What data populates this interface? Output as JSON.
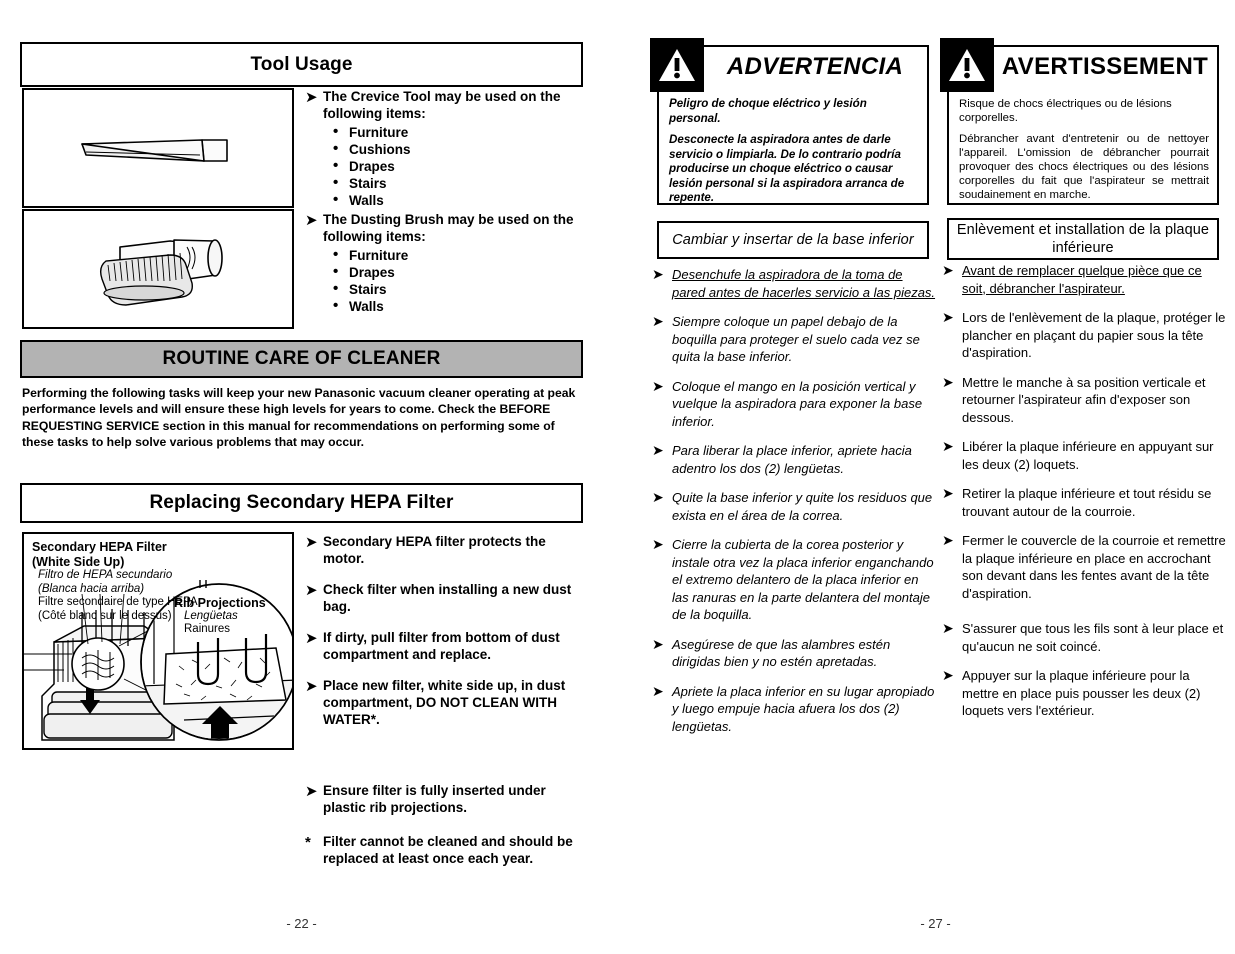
{
  "left_page": {
    "tool_usage": {
      "title": "Tool Usage",
      "crevice_figure_name": "crevice-tool-illustration",
      "brush_figure_name": "dusting-brush-illustration",
      "bullets": [
        {
          "text": "The Crevice Tool may be used on the following items:",
          "sub": [
            "Furniture",
            "Cushions",
            "Drapes",
            "Stairs",
            "Walls"
          ]
        },
        {
          "text": "The Dusting Brush may be used on the following items:",
          "sub": [
            "Furniture",
            "Drapes",
            "Stairs",
            "Walls"
          ]
        }
      ]
    },
    "routine_care": {
      "banner": "ROUTINE CARE OF CLEANER",
      "paragraph": "Performing the following tasks will keep your new Panasonic vacuum cleaner operating at peak performance levels and will ensure these high levels for years to come. Check the BEFORE REQUESTING SERVICE section in this manual for recommendations on performing some of these tasks to help solve various problems that may occur."
    },
    "hepa": {
      "title": "Replacing Secondary HEPA Filter",
      "figure_labels": {
        "main_en_line1": "Secondary HEPA Filter",
        "main_en_line2": "(White Side Up)",
        "main_es_line1": "Filtro de HEPA secundario",
        "main_es_line2": "(Blanca hacia arriba)",
        "main_fr_line1": "Filtre secondaire de type HEPA",
        "main_fr_line2": "(Côté blanc sur le dessus)",
        "rib_en": "Rib Projections",
        "rib_es": "Lengüetas",
        "rib_fr": "Rainures"
      },
      "bullets": [
        "Secondary HEPA filter protects the motor.",
        "Check filter when installing a new dust bag.",
        "If dirty, pull filter from bottom of dust compartment and replace.",
        "Place new filter, white side up, in dust compartment, DO NOT CLEAN WITH WATER*."
      ],
      "bullets_lower": [
        "Ensure filter is fully inserted under plastic rib projections."
      ],
      "footnote_marker": "*",
      "footnote": "Filter cannot be cleaned and should be replaced at least once each year."
    },
    "page_number": "- 22 -"
  },
  "right_page": {
    "spanish": {
      "warning_word": "ADVERTENCIA",
      "warning_icon": "warning-triangle-icon",
      "warning_paragraphs": [
        "Peligro de choque eléctrico y lesión personal.",
        "Desconecte la aspiradora antes de darle servicio o limpiarla.  De lo contrario podría producirse un choque eléctrico o causar lesión personal si la aspiradora arranca de repente."
      ],
      "subtitle": "Cambiar y insertar de la base inferior",
      "bullets": [
        {
          "text": "Desenchufe la aspiradora de la toma de pared antes de hacerles servicio a las piezas.",
          "underline": true
        },
        {
          "text": "Siempre coloque un papel debajo de la boquilla para proteger el suelo cada vez se quita la base inferior.",
          "underline": false
        },
        {
          "text": "Coloque el mango en la posición vertical y vuelque la aspiradora para exponer la base inferior.",
          "underline": false
        },
        {
          "text": "Para liberar la place inferior, apriete hacia adentro los dos (2) lengüetas.",
          "underline": false
        },
        {
          "text": "Quite la base inferior y quite los residuos que exista en el área de la correa.",
          "underline": false
        },
        {
          "text": "Cierre la cubierta de la corea posterior y instale otra vez la placa inferior enganchando el extremo delantero de la placa inferior en las ranuras en la parte delantera del montaje de la boquilla.",
          "underline": false
        },
        {
          "text": "Asegúrese de que las alambres estén dirigidas bien y no estén apretadas.",
          "underline": false
        },
        {
          "text": "Apriete la placa inferior en su lugar apropiado y luego empuje hacia afuera los dos (2) lengüetas.",
          "underline": false
        }
      ]
    },
    "french": {
      "warning_word": "AVERTISSEMENT",
      "warning_icon": "warning-triangle-icon",
      "warning_paragraphs": [
        "Risque de chocs électriques ou de lésions corporelles.",
        "Débrancher avant d'entretenir ou de nettoyer l'appareil. L'omission de débrancher pourrait provoquer des chocs électriques ou des lésions corporelles du fait que l'aspirateur se mettrait soudainement en marche."
      ],
      "subtitle": "Enlèvement et installation de la plaque inférieure",
      "bullets": [
        {
          "text": "Avant de remplacer quelque pièce que ce soit, débrancher l'aspirateur.",
          "underline": true
        },
        {
          "text": "Lors de l'enlèvement de la plaque, protéger le plancher en plaçant du papier sous la tête d'aspiration.",
          "underline": false
        },
        {
          "text": "Mettre le manche à sa position verticale et retourner l'aspirateur afin d'exposer son dessous.",
          "underline": false
        },
        {
          "text": "Libérer la plaque inférieure en appuyant sur les deux (2) loquets.",
          "underline": false
        },
        {
          "text": "Retirer la plaque inférieure et tout résidu se trouvant autour de la courroie.",
          "underline": false
        },
        {
          "text": "Fermer le couvercle de la courroie et remettre la plaque inférieure en place en accrochant son devant dans les fentes avant de la tête d'aspiration.",
          "underline": false
        },
        {
          "text": "S'assurer que tous les fils sont à leur place et qu'aucun ne soit coincé.",
          "underline": false
        },
        {
          "text": "Appuyer sur la plaque inférieure pour la mettre en place puis pousser les deux (2) loquets vers l'extérieur.",
          "underline": false
        }
      ]
    },
    "page_number": "- 27 -"
  },
  "colors": {
    "banner_grey": "#b3b3b3",
    "ink": "#000000",
    "paper": "#ffffff"
  }
}
